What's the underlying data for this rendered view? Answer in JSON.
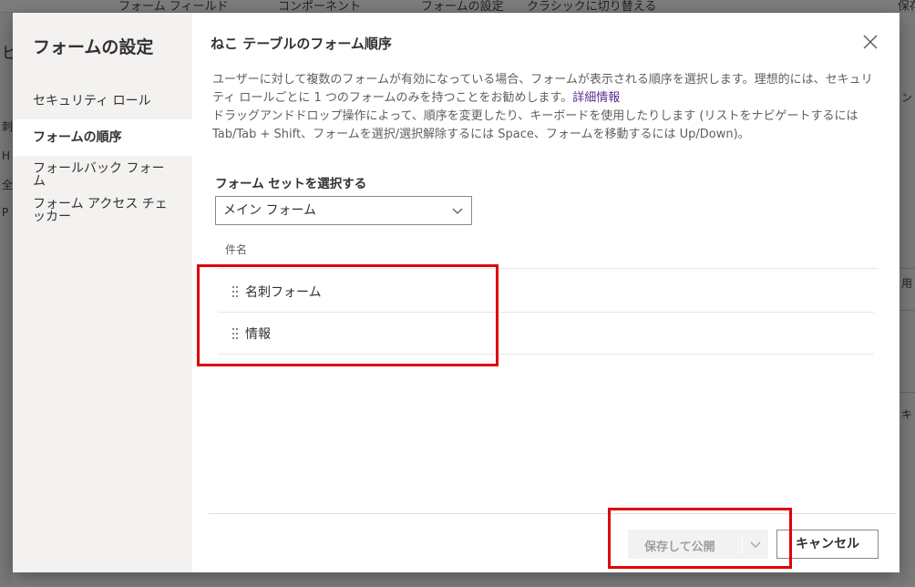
{
  "background": {
    "toolbar_items": [
      "フォーム フィールド",
      "コンポーネント",
      "フォームの設定",
      "クラシックに切り替える",
      "保存"
    ],
    "left_chars": [
      "ビ",
      "刺",
      "H",
      "全",
      "P"
    ],
    "right_chars": [
      "ン",
      "用",
      "キ ("
    ]
  },
  "nav": {
    "title": "フォームの設定",
    "items": [
      {
        "label": "セキュリティ ロール"
      },
      {
        "label": "フォームの順序"
      },
      {
        "label": "フォールバック フォーム"
      },
      {
        "label": "フォーム アクセス チェッカー"
      }
    ]
  },
  "dialog": {
    "title": "ねこ テーブルのフォーム順序",
    "description_1": "ユーザーに対して複数のフォームが有効になっている場合、フォームが表示される順序を選択します。理想的には、セキュリティ ロールごとに 1 つのフォームのみを持つことをお勧めします。",
    "more_info_link": "詳細情報",
    "description_2": "ドラッグアンドドロップ操作によって、順序を変更したり、キーボードを使用したりします (リストをナビゲートするには Tab/Tab + Shift、フォームを選択/選択解除するには Space、フォームを移動するには Up/Down)。",
    "form_set_label": "フォーム セットを選択する",
    "form_set_value": "メイン フォーム",
    "column_header": "件名",
    "forms": [
      {
        "name": "名刺フォーム"
      },
      {
        "name": "情報"
      }
    ],
    "save_button": "保存して公開",
    "cancel_button": "キャンセル"
  },
  "colors": {
    "highlight": "#e00000",
    "link": "#5c2d91"
  }
}
